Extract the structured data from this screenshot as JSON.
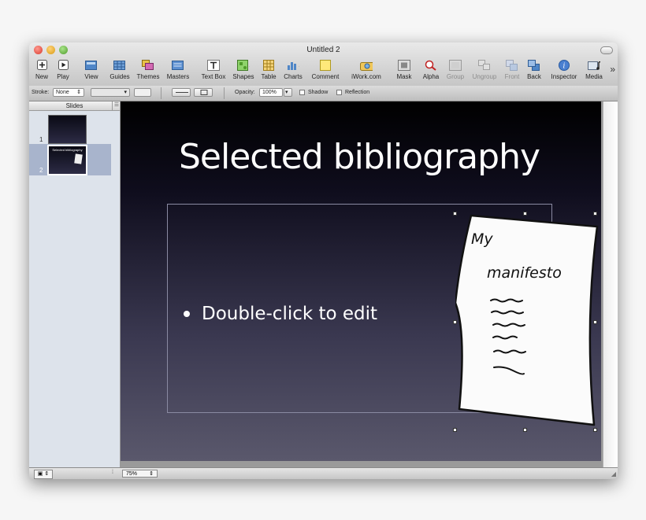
{
  "window": {
    "title": "Untitled 2"
  },
  "toolbar": {
    "items": [
      {
        "label": "New",
        "icon": "plus-icon",
        "dim": false
      },
      {
        "label": "Play",
        "icon": "play-icon",
        "dim": false
      },
      {
        "label": "View",
        "icon": "view-icon",
        "dim": false
      },
      {
        "label": "Guides",
        "icon": "grid-icon",
        "dim": false
      },
      {
        "label": "Themes",
        "icon": "themes-icon",
        "dim": false
      },
      {
        "label": "Masters",
        "icon": "masters-icon",
        "dim": false
      },
      {
        "label": "Text Box",
        "icon": "text-box-icon",
        "dim": false
      },
      {
        "label": "Shapes",
        "icon": "shapes-icon",
        "dim": false
      },
      {
        "label": "Table",
        "icon": "table-icon",
        "dim": false
      },
      {
        "label": "Charts",
        "icon": "charts-icon",
        "dim": false
      },
      {
        "label": "Comment",
        "icon": "comment-icon",
        "dim": false
      },
      {
        "label": "iWork.com",
        "icon": "iwork-icon",
        "dim": false
      },
      {
        "label": "Mask",
        "icon": "mask-icon",
        "dim": false
      },
      {
        "label": "Alpha",
        "icon": "alpha-icon",
        "dim": false
      },
      {
        "label": "Group",
        "icon": "group-icon",
        "dim": true
      },
      {
        "label": "Ungroup",
        "icon": "ungroup-icon",
        "dim": true
      },
      {
        "label": "Front",
        "icon": "front-icon",
        "dim": true
      },
      {
        "label": "Back",
        "icon": "back-icon",
        "dim": false
      },
      {
        "label": "Inspector",
        "icon": "info-icon",
        "dim": false
      },
      {
        "label": "Media",
        "icon": "media-icon",
        "dim": false
      }
    ],
    "overflow": "»"
  },
  "format_bar": {
    "stroke_label": "Stroke:",
    "stroke_value": "None",
    "opacity_label": "Opacity:",
    "opacity_value": "100%",
    "shadow_label": "Shadow",
    "reflection_label": "Reflection"
  },
  "sidebar": {
    "header": "Slides",
    "slides": [
      {
        "number": "1",
        "caption": ""
      },
      {
        "number": "2",
        "caption": "Selected bibliography"
      }
    ]
  },
  "slide": {
    "title": "Selected bibliography",
    "bullet": "Double-click to edit",
    "note_line1": "My",
    "note_line2": "manifesto"
  },
  "bottom_bar": {
    "zoom": "75%"
  },
  "colors": {
    "slide_top": "#000000",
    "slide_bottom": "#5a586c",
    "selection": "#a8b4cc"
  }
}
